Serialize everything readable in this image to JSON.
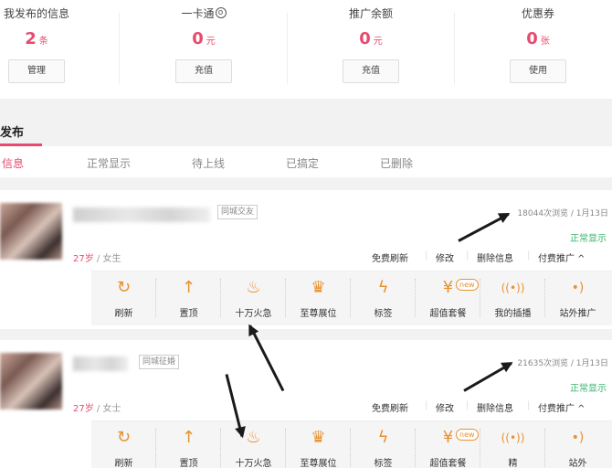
{
  "stats": [
    {
      "label": "我发布的信息",
      "value": "2",
      "unit": "条",
      "button": "管理"
    },
    {
      "label": "一卡通",
      "info": "o",
      "value": "0",
      "unit": "元",
      "button": "充值"
    },
    {
      "label": "推广余额",
      "value": "0",
      "unit": "元",
      "button": "充值"
    },
    {
      "label": "优惠券",
      "value": "0",
      "unit": "张",
      "button": "使用"
    }
  ],
  "section": {
    "title": "发布"
  },
  "tabs": [
    "信息",
    "正常显示",
    "待上线",
    "已搞定",
    "已删除"
  ],
  "posts": [
    {
      "tag": "同城交友",
      "age": "27岁",
      "gender": "女生",
      "views": "18044次浏览 / 1月13日",
      "status": "正常显示",
      "actions": [
        "免费刷新",
        "修改",
        "删除信息",
        "付费推广 ^"
      ]
    },
    {
      "tag": "同城征婚",
      "age": "27岁",
      "gender": "女士",
      "views": "21635次浏览 / 1月13日",
      "status": "正常显示",
      "actions": [
        "免费刷新",
        "修改",
        "删除信息",
        "付费推广 ^"
      ]
    }
  ],
  "tools": [
    {
      "label": "刷新",
      "icon": "refresh-icon",
      "glyph": "↻"
    },
    {
      "label": "置顶",
      "icon": "arrow-up-icon",
      "glyph": "↑"
    },
    {
      "label": "十万火急",
      "icon": "flame-icon",
      "glyph": "♨"
    },
    {
      "label": "至尊展位",
      "icon": "crown-icon",
      "glyph": "♛"
    },
    {
      "label": "标签",
      "icon": "lightning-icon",
      "glyph": "ϟ"
    },
    {
      "label": "超值套餐",
      "icon": "yen-coin-icon",
      "glyph": "¥",
      "badge": "new"
    },
    {
      "label": "我的插播",
      "icon": "broadcast-icon",
      "glyph": "((•))"
    },
    {
      "label": "站外推广",
      "icon": "signal-icon",
      "glyph": "•)"
    }
  ],
  "tools_partial_row2": {
    "7": "精",
    "8": "站外"
  },
  "colors": {
    "accent": "#e64b6f",
    "icon": "#e8912f",
    "status": "#3cb371"
  }
}
